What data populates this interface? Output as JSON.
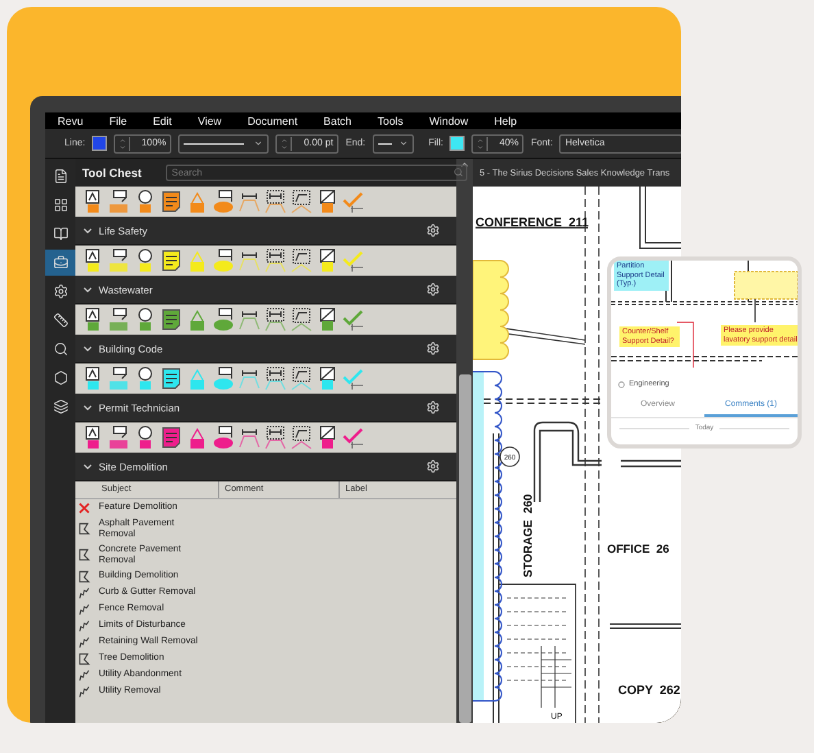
{
  "menu": [
    "Revu",
    "File",
    "Edit",
    "View",
    "Document",
    "Batch",
    "Tools",
    "Window",
    "Help"
  ],
  "toolbar": {
    "line_label": "Line:",
    "line": {
      "color": "#2146e8"
    },
    "zoom": "100%",
    "thickness": "0.00 pt",
    "end_label": "End:",
    "fill_label": "Fill:",
    "fill": {
      "color": "#3ee6f2"
    },
    "opacity": "40%",
    "font_label": "Font:",
    "font": "Helvetica"
  },
  "rail": [
    {
      "selected": false
    },
    {
      "selected": false
    },
    {
      "selected": false
    },
    {
      "selected": true
    },
    {
      "selected": false
    },
    {
      "selected": false
    },
    {
      "selected": false
    },
    {
      "selected": false
    },
    {
      "selected": false
    }
  ],
  "panel": {
    "title": "Tool Chest",
    "search": {
      "placeholder": "Search"
    },
    "sections": [
      {
        "kind": "tools",
        "color": "#f28a1a",
        "expanded": true
      },
      {
        "kind": "tools",
        "title": "Life Safety",
        "color": "#f4ea1c",
        "expanded": true
      },
      {
        "kind": "tools",
        "title": "Wastewater",
        "color": "#5fa83a",
        "expanded": true
      },
      {
        "kind": "tools",
        "title": "Building Code",
        "color": "#2ee6ee",
        "expanded": true
      },
      {
        "kind": "tools",
        "title": "Permit Technician",
        "color": "#ee1e8c",
        "expanded": true
      },
      {
        "kind": "list",
        "title": "Site Demolition",
        "expanded": true
      }
    ]
  },
  "subjects": {
    "columns": [
      "Subject",
      "Comment",
      "Label"
    ],
    "rows": [
      {
        "kind": "x",
        "subject": "Feature Demolition"
      },
      {
        "kind": "area",
        "subject": "Asphalt Pavement Removal"
      },
      {
        "kind": "area",
        "subject": "Concrete Pavement Removal"
      },
      {
        "kind": "area",
        "subject": "Building Demolition"
      },
      {
        "kind": "line",
        "subject": "Curb & Gutter Removal"
      },
      {
        "kind": "line",
        "subject": "Fence Removal"
      },
      {
        "kind": "line",
        "subject": "Limits of Disturbance"
      },
      {
        "kind": "line",
        "subject": "Retaining Wall Removal"
      },
      {
        "kind": "area",
        "subject": "Tree Demolition"
      },
      {
        "kind": "line",
        "subject": "Utility Abandonment"
      },
      {
        "kind": "line",
        "subject": "Utility Removal"
      }
    ]
  },
  "document": {
    "tab": "5 - The Sirius Decisions Sales Knowledge Trans",
    "labels": [
      "CONFERENCE  211",
      "260",
      "STORAGE  260",
      "OFFICE  26",
      "COPY  262",
      "UP"
    ]
  },
  "preview": {
    "notes": [
      "Partition Support Detail (Typ.)",
      "Counter/Shelf Support Detail?",
      "Please provide lavatory support detail"
    ],
    "discipline": "Engineering",
    "tabs": [
      {
        "label": "Overview",
        "selected": false
      },
      {
        "label": "Comments (1)",
        "selected": true
      }
    ],
    "date": "Today"
  }
}
